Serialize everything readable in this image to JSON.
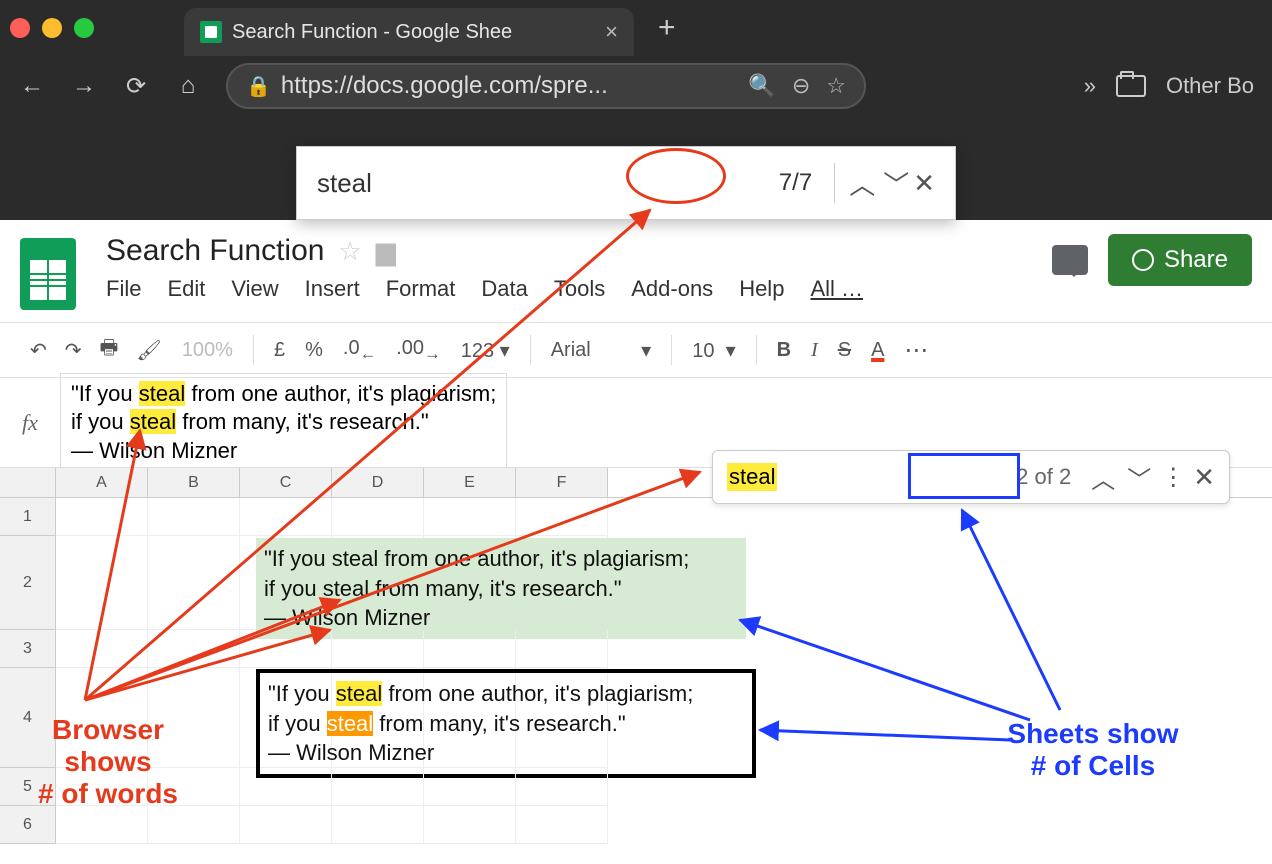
{
  "browser": {
    "tab_title": "Search Function - Google Shee",
    "url": "https://docs.google.com/spre...",
    "other_bookmarks": "Other Bo",
    "find": {
      "term": "steal",
      "count": "7/7"
    }
  },
  "doc": {
    "title": "Search Function",
    "menus": {
      "file": "File",
      "edit": "Edit",
      "view": "View",
      "insert": "Insert",
      "format": "Format",
      "data": "Data",
      "tools": "Tools",
      "addons": "Add-ons",
      "help": "Help",
      "all": "All …"
    },
    "share": "Share"
  },
  "toolbar": {
    "zoom": "100%",
    "currency": "£",
    "percent": "%",
    "dec_dec": ".0",
    "dec_inc": ".00",
    "numfmt": "123",
    "font": "Arial",
    "size": "10",
    "bold": "B",
    "italic": "I",
    "strike": "S",
    "textcolor": "A",
    "more": "⋯"
  },
  "formula": {
    "line1_pre": "\"If you ",
    "hl": "steal",
    "line1_mid": " from one author, it's plagiarism;",
    "line2_pre": "if you ",
    "line2_post": " from many, it's research.\"",
    "line3": "― Wilson Mizner"
  },
  "columns": [
    "A",
    "B",
    "C",
    "D",
    "E",
    "F"
  ],
  "rows": [
    "1",
    "2",
    "3",
    "4",
    "5",
    "6"
  ],
  "quote": {
    "l1": "\"If you steal from one author, it's plagiarism;",
    "l2": "if you steal from many, it's research.\"",
    "l3": "― Wilson Mizner",
    "l1a": "\"If you ",
    "l1b": " from one author, it's plagiarism;",
    "l2a": "if you ",
    "l2b": " from many, it's research.\""
  },
  "sheets_find": {
    "term": "steal",
    "count": "2 of 2"
  },
  "annotations": {
    "red_l1": "Browser shows",
    "red_l2": "# of words",
    "blue_l1": "Sheets show",
    "blue_l2": "# of Cells"
  }
}
